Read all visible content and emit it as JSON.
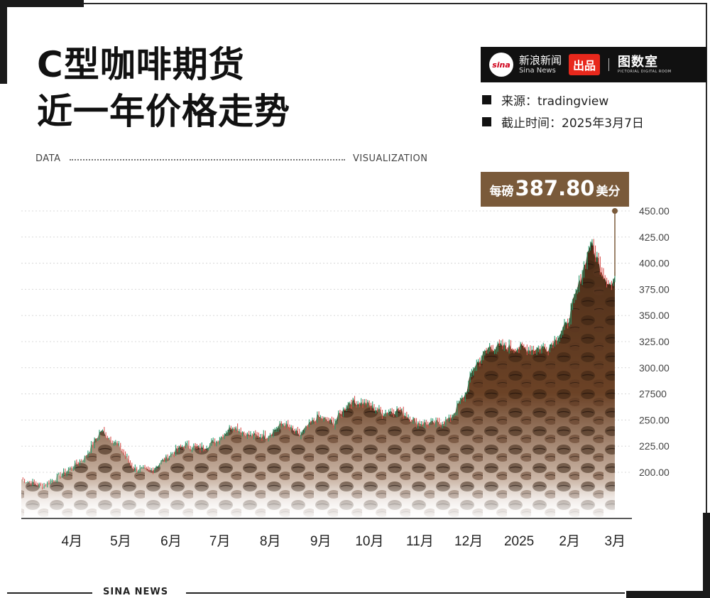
{
  "title": {
    "line1": "C型咖啡期货",
    "line2": "近一年价格走势"
  },
  "brand": {
    "logo_text": "sina",
    "name": "新浪新闻",
    "name_sub": "Sina News",
    "produced": "出品",
    "room": "图数室",
    "room_sub": "PICTORIAL DIGITAL ROOM"
  },
  "meta": {
    "source": "来源：tradingview",
    "cutoff": "截止时间：2025年3月7日"
  },
  "band": {
    "left": "DATA",
    "right": "VISUALIZATION"
  },
  "callout": {
    "prefix": "每磅",
    "value": "387.80",
    "suffix": "美分"
  },
  "footer": {
    "text": "SINA NEWS"
  },
  "colors": {
    "up": "#2a9d6f",
    "down": "#d9534f",
    "coffee": "#6b4226",
    "callout_bg": "#7a5a3a",
    "accent_red": "#e8281c"
  },
  "chart_data": {
    "type": "line",
    "x_tick_labels": [
      "4月",
      "5月",
      "6月",
      "7月",
      "8月",
      "9月",
      "10月",
      "11月",
      "12月",
      "2025",
      "2月",
      "3月"
    ],
    "y_tick_labels": [
      "200.00",
      "225.00",
      "250.00",
      "27500",
      "300.00",
      "325.00",
      "350.00",
      "375.00",
      "400.00",
      "425.00",
      "450.00"
    ],
    "ylim": [
      175,
      450
    ],
    "grid": true,
    "series": [
      {
        "x": [
          "2024-03-07",
          "2024-03-20",
          "2024-04-01",
          "2024-04-15",
          "2024-04-25",
          "2024-05-06",
          "2024-05-15",
          "2024-05-25",
          "2024-06-05",
          "2024-06-15",
          "2024-06-25",
          "2024-07-05",
          "2024-07-15",
          "2024-07-25",
          "2024-08-05",
          "2024-08-15",
          "2024-08-25",
          "2024-09-05",
          "2024-09-15",
          "2024-09-25",
          "2024-10-05",
          "2024-10-15",
          "2024-10-25",
          "2024-11-05",
          "2024-11-15",
          "2024-11-25",
          "2024-12-05",
          "2024-12-10",
          "2024-12-20",
          "2025-01-01",
          "2025-01-15",
          "2025-01-25",
          "2025-02-05",
          "2025-02-12",
          "2025-02-20",
          "2025-02-28",
          "2025-03-05",
          "2025-03-07"
        ],
        "values": [
          193,
          187,
          198,
          214,
          240,
          225,
          204,
          201,
          215,
          226,
          223,
          230,
          245,
          235,
          235,
          247,
          235,
          253,
          247,
          268,
          266,
          257,
          260,
          248,
          246,
          250,
          275,
          300,
          320,
          320,
          318,
          320,
          340,
          375,
          420,
          390,
          378,
          387.8
        ]
      }
    ],
    "annotation": "每磅387.80美分"
  }
}
